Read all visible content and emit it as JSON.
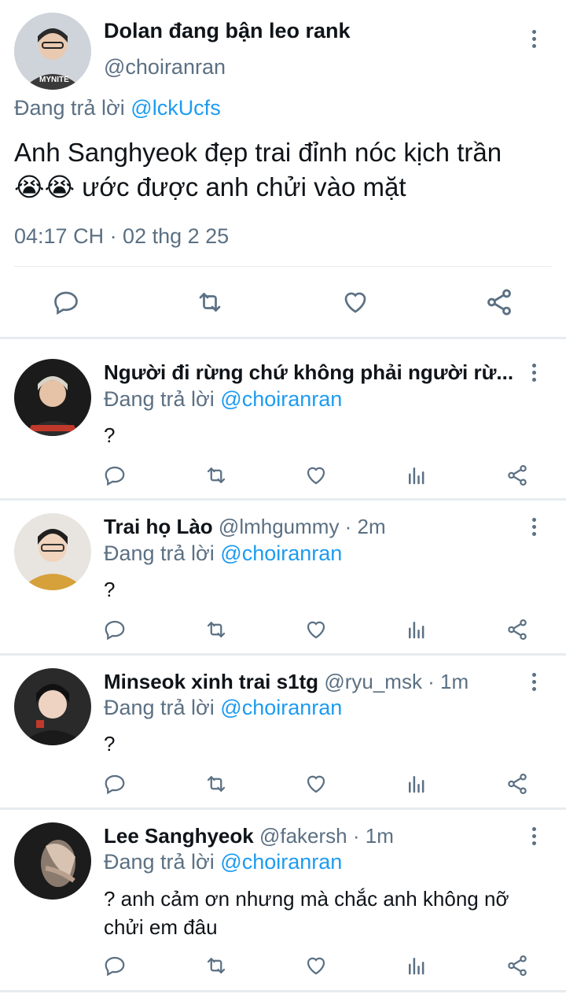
{
  "colors": {
    "link": "#1d9bf0",
    "muted": "#5b7083",
    "text": "#0f1419",
    "divider": "#e6ecf0"
  },
  "main_tweet": {
    "display_name": "Dolan đang bận leo rank",
    "handle": "@choiranran",
    "reply_prefix": "Đang trả lời",
    "reply_to": "@lckUcfs",
    "text_line1": "Anh Sanghyeok đẹp trai đỉnh nóc kịch trần",
    "emoji": "😭😭",
    "text_line2": " ước được anh chửi vào mặt",
    "timestamp": "04:17 CH · 02 thg 2 25",
    "actions": [
      "reply-icon",
      "retweet-icon",
      "like-icon",
      "share-icon"
    ]
  },
  "replies": [
    {
      "display_name": "Người đi rừng chứ không phải người rừ...",
      "handle": "",
      "time": "",
      "reply_prefix": "Đang trả lời",
      "reply_to": "@choiranran",
      "text": "?"
    },
    {
      "display_name": "Trai họ Lào",
      "handle": "@lmhgummy",
      "time": " · 2m",
      "reply_prefix": "Đang trả lời",
      "reply_to": "@choiranran",
      "text": "?"
    },
    {
      "display_name": "Minseok xinh trai s1tg",
      "handle": "@ryu_msk",
      "time": " · 1m",
      "reply_prefix": "Đang trả lời",
      "reply_to": "@choiranran",
      "text": "?"
    },
    {
      "display_name": "Lee Sanghyeok",
      "handle": "@fakersh",
      "time": " · 1m",
      "reply_prefix": "Đang trả lời",
      "reply_to": "@choiranran",
      "text_line1": "? anh cảm ơn nhưng mà chắc anh không nỡ",
      "text_line2": "chửi em đâu"
    }
  ],
  "reply_actions": [
    "reply-icon",
    "retweet-icon",
    "like-icon",
    "views-icon",
    "share-icon"
  ]
}
